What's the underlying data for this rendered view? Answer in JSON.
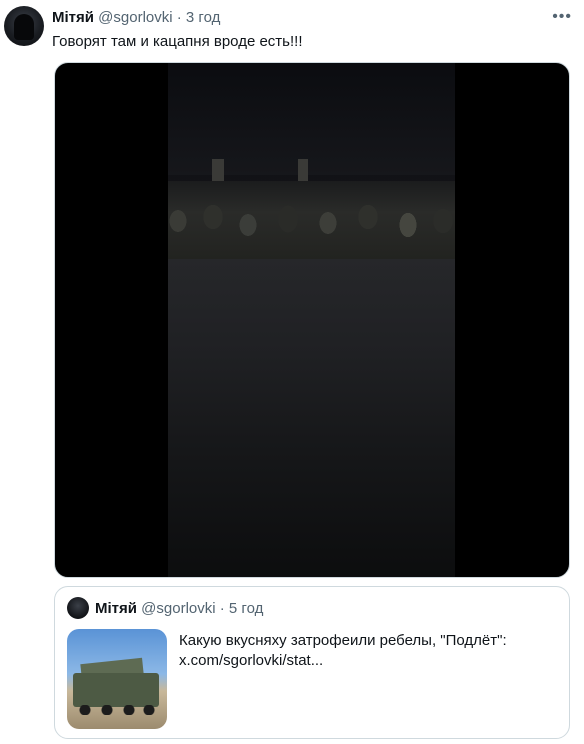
{
  "tweet": {
    "author_name": "Мітяй",
    "handle": "@sgorlovki",
    "separator": "·",
    "time": "3 год",
    "more_icon": "more-horizontal-icon",
    "text": "Говорят там и кацапня вроде есть!!!"
  },
  "quoted_tweet": {
    "author_name": "Мітяй",
    "handle": "@sgorlovki",
    "separator": "·",
    "time": "5 год",
    "text_line1": "Какую вкусняху затрофеили ребелы, \"Подлёт\":",
    "text_line2": "x.com/sgorlovki/stat..."
  },
  "colors": {
    "text_primary": "#0f1419",
    "text_secondary": "#536471",
    "border": "#cfd9de"
  }
}
